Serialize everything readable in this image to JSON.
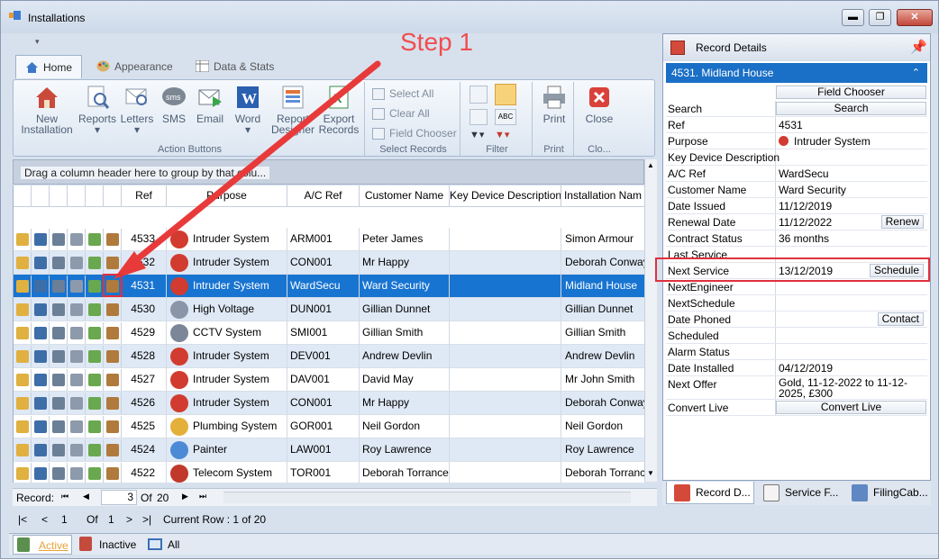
{
  "window": {
    "title": "Installations",
    "min": "▬",
    "max": "❐",
    "close": "✕"
  },
  "annotation": {
    "step_label": "Step 1"
  },
  "ribbon": {
    "tabs": [
      {
        "label": "Home"
      },
      {
        "label": "Appearance"
      },
      {
        "label": "Data & Stats"
      }
    ],
    "action_buttons": {
      "new_installation": "New Installation",
      "reports": "Reports",
      "letters": "Letters",
      "sms": "SMS",
      "email": "Email",
      "word": "Word",
      "report_designer": "Report Designer",
      "export_records": "Export Records",
      "group_label": "Action Buttons"
    },
    "select_records": {
      "select_all": "Select All",
      "clear_all": "Clear All",
      "field_chooser": "Field Chooser",
      "group_label": "Select Records"
    },
    "filter": {
      "group_label": "Filter"
    },
    "print": {
      "label": "Print",
      "group_label": "Print"
    },
    "close": {
      "label": "Close",
      "group_label": "Clo..."
    }
  },
  "grid": {
    "group_hint": "Drag a column header here to group by that colu...",
    "columns": [
      "Ref",
      "Purpose",
      "A/C Ref",
      "Customer Name",
      "Key Device Description",
      "Installation Nam"
    ],
    "rows": [
      {
        "ref": "4533",
        "purpose": "Intruder System",
        "ac_ref": "ARM001",
        "customer": "Peter James",
        "kdd": "",
        "install": "Simon Armour",
        "icon": "alarm-bell-icon"
      },
      {
        "ref": "4532",
        "purpose": "Intruder System",
        "ac_ref": "CON001",
        "customer": "Mr Happy",
        "kdd": "",
        "install": "Deborah Conway",
        "icon": "alarm-bell-icon"
      },
      {
        "ref": "4531",
        "purpose": "Intruder System",
        "ac_ref": "WardSecu",
        "customer": "Ward Security",
        "kdd": "",
        "install": "Midland House",
        "icon": "alarm-bell-icon"
      },
      {
        "ref": "4530",
        "purpose": "High Voltage",
        "ac_ref": "DUN001",
        "customer": "Gillian Dunnet",
        "kdd": "",
        "install": "Gillian Dunnet",
        "icon": "generator-icon"
      },
      {
        "ref": "4529",
        "purpose": "CCTV System",
        "ac_ref": "SMI001",
        "customer": "Gillian Smith",
        "kdd": "",
        "install": "Gillian Smith",
        "icon": "camera-icon"
      },
      {
        "ref": "4528",
        "purpose": "Intruder System",
        "ac_ref": "DEV001",
        "customer": "Andrew Devlin",
        "kdd": "",
        "install": "Andrew Devlin",
        "icon": "alarm-bell-icon"
      },
      {
        "ref": "4527",
        "purpose": "Intruder System",
        "ac_ref": "DAV001",
        "customer": "David May",
        "kdd": "",
        "install": "Mr John Smith",
        "icon": "alarm-bell-icon"
      },
      {
        "ref": "4526",
        "purpose": "Intruder System",
        "ac_ref": "CON001",
        "customer": "Mr Happy",
        "kdd": "",
        "install": "Deborah Conway",
        "icon": "alarm-bell-icon"
      },
      {
        "ref": "4525",
        "purpose": "Plumbing System",
        "ac_ref": "GOR001",
        "customer": "Neil Gordon",
        "kdd": "",
        "install": "Neil Gordon",
        "icon": "plumber-icon"
      },
      {
        "ref": "4524",
        "purpose": "Painter",
        "ac_ref": "LAW001",
        "customer": "Roy Lawrence",
        "kdd": "",
        "install": "Roy Lawrence",
        "icon": "paint-bucket-icon"
      },
      {
        "ref": "4522",
        "purpose": "Telecom System",
        "ac_ref": "TOR001",
        "customer": "Deborah Torrance",
        "kdd": "",
        "install": "Deborah Torrance",
        "icon": "phone-box-icon"
      }
    ]
  },
  "record_nav": {
    "label": "Record:",
    "first": "⏮",
    "prev": "◀",
    "current": "3",
    "of": "Of",
    "total": "20",
    "next": "▶",
    "last": "⏭"
  },
  "pager": {
    "first": "|<",
    "prev": "<",
    "page": "1",
    "of": "Of",
    "total": "1",
    "next": ">",
    "last": ">|",
    "current_row": "Current Row : 1 of 20"
  },
  "status_tabs": [
    {
      "label": "Active"
    },
    {
      "label": "Inactive"
    },
    {
      "label": "All"
    }
  ],
  "details": {
    "header": "Record Details",
    "record_title": "4531. Midland House",
    "field_chooser": "Field Chooser",
    "rows": [
      {
        "key": "Search",
        "value": "",
        "button": "Search"
      },
      {
        "key": "Ref",
        "value": "4531"
      },
      {
        "key": "Purpose",
        "value": "Intruder System"
      },
      {
        "key": "Key Device Description",
        "value": ""
      },
      {
        "key": "A/C Ref",
        "value": "WardSecu"
      },
      {
        "key": "Customer Name",
        "value": "Ward Security"
      },
      {
        "key": "Date Issued",
        "value": "11/12/2019"
      },
      {
        "key": "Renewal Date",
        "value": "11/12/2022",
        "button": "Renew"
      },
      {
        "key": "Contract Status",
        "value": "36 months"
      },
      {
        "key": "Last Service",
        "value": ""
      },
      {
        "key": "Next Service",
        "value": "13/12/2019",
        "button": "Schedule"
      },
      {
        "key": "NextEngineer",
        "value": ""
      },
      {
        "key": "NextSchedule",
        "value": ""
      },
      {
        "key": "Date Phoned",
        "value": "",
        "button": "Contact"
      },
      {
        "key": "Scheduled",
        "value": ""
      },
      {
        "key": "Alarm Status",
        "value": ""
      },
      {
        "key": "Date Installed",
        "value": "04/12/2019"
      },
      {
        "key": "Next Offer",
        "value": "Gold, 11-12-2022 to 11-12-2025, £300"
      },
      {
        "key": "Convert Live",
        "value": "",
        "button": "Convert Live"
      }
    ],
    "tabs": [
      {
        "label": "Record D..."
      },
      {
        "label": "Service F..."
      },
      {
        "label": "FilingCab..."
      }
    ]
  }
}
